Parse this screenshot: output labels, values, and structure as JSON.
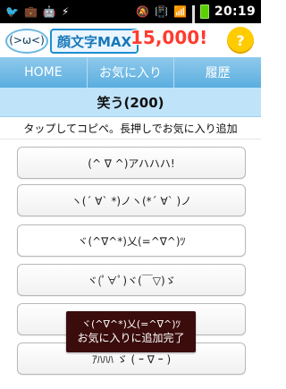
{
  "status_bar": {
    "left_icons": [
      "twitter-bird-icon",
      "briefcase-icon",
      "android-icon",
      "usb-icon"
    ],
    "right_icons": [
      "mute-icon",
      "vibrate-icon",
      "wifi-icon",
      "signal-icon",
      "battery-icon"
    ],
    "time": "20:19"
  },
  "app": {
    "logo_face": "(>ω<)",
    "title": "顔文字MAX",
    "count": "15,000!",
    "help_symbol": "?"
  },
  "nav": {
    "tabs": [
      "HOME",
      "お気に入り",
      "履歴"
    ]
  },
  "category": {
    "title": "笑う(200)"
  },
  "hint": "タップしてコピペ。長押しでお気に入り追加",
  "list": {
    "items": [
      "(^ ∇ ^)アハハハ!",
      "ヽ(´ ∀` *)ノヽ(*´ ∀` )ノ",
      "ヾ(^∇^*)乂(=^∇^)ﾂ",
      "ヾ(ﾟ∀ﾟ)ヾ(￣▽)ゞ",
      "",
      "ｱﾊﾊﾊ ゞ ( ｰ ∇ ｰ )"
    ]
  },
  "toast": {
    "line1": "ヾ(^∇^*)乂(=^∇^)ﾂ",
    "line2": "お気に入りに追加完了"
  },
  "colors": {
    "nav_top": "#8fc9ec",
    "nav_bottom": "#5aaedf",
    "category_bg": "#bfe3f8",
    "toast_bg": "#3b0c0c",
    "help_btn": "#ffcc00"
  }
}
